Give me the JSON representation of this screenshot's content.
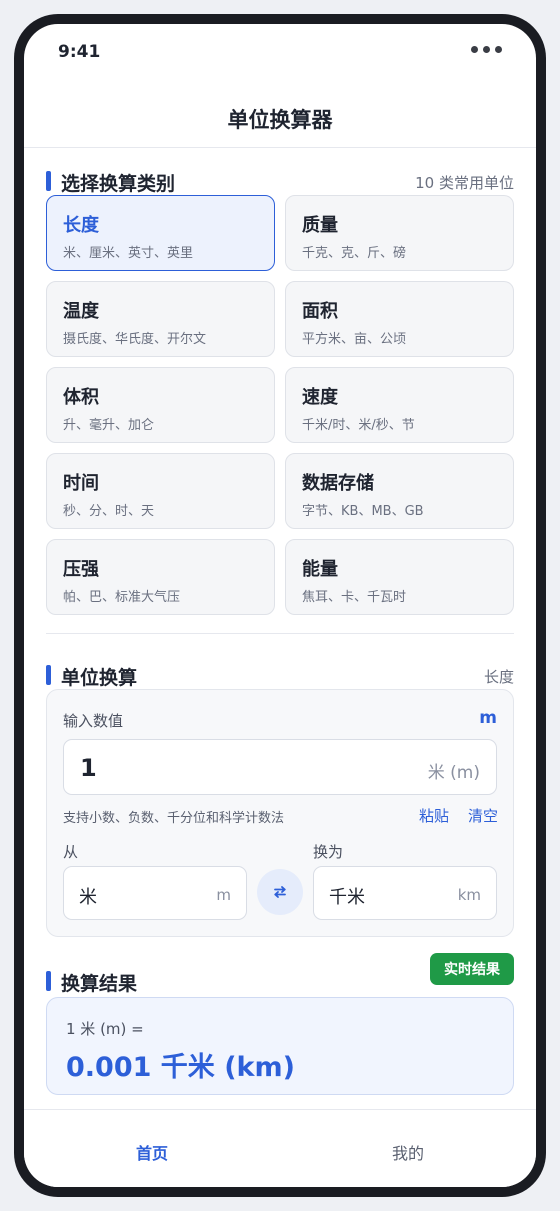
{
  "status": {
    "time": "9:41",
    "menu_icon": "more-dots-icon"
  },
  "header": {
    "title": "单位换算器"
  },
  "categories": {
    "title": "选择换算类别",
    "note": "10 类常用单位",
    "items": [
      {
        "name": "长度",
        "units": "米、厘米、英寸、英里",
        "selected": true
      },
      {
        "name": "质量",
        "units": "千克、克、斤、磅"
      },
      {
        "name": "温度",
        "units": "摄氏度、华氏度、开尔文"
      },
      {
        "name": "面积",
        "units": "平方米、亩、公顷"
      },
      {
        "name": "体积",
        "units": "升、毫升、加仑"
      },
      {
        "name": "速度",
        "units": "千米/时、米/秒、节"
      },
      {
        "name": "时间",
        "units": "秒、分、时、天"
      },
      {
        "name": "数据存储",
        "units": "字节、KB、MB、GB"
      },
      {
        "name": "压强",
        "units": "帕、巴、标准大气压"
      },
      {
        "name": "能量",
        "units": "焦耳、卡、千瓦时"
      }
    ]
  },
  "converter": {
    "title": "单位换算",
    "current_category": "长度",
    "input_label": "输入数值",
    "input_unit_tag": "m",
    "input_value": "1",
    "input_suffix": "米 (m)",
    "hint": "支持小数、负数、千分位和科学计数法",
    "paste_label": "粘贴",
    "clear_label": "清空",
    "from_label": "从",
    "to_label": "换为",
    "from_unit": {
      "name": "米",
      "symbol": "m"
    },
    "to_unit": {
      "name": "千米",
      "symbol": "km"
    },
    "swap_icon": "swap-arrows-icon"
  },
  "result": {
    "title": "换算结果",
    "badge": "实时结果",
    "expression": "1 米 (m) =",
    "value": "0.001 千米 (km)"
  },
  "tabbar": {
    "home_label": "首页",
    "mine_label": "我的"
  },
  "colors": {
    "accent": "#2d5fd8",
    "success": "#1f9a47"
  }
}
